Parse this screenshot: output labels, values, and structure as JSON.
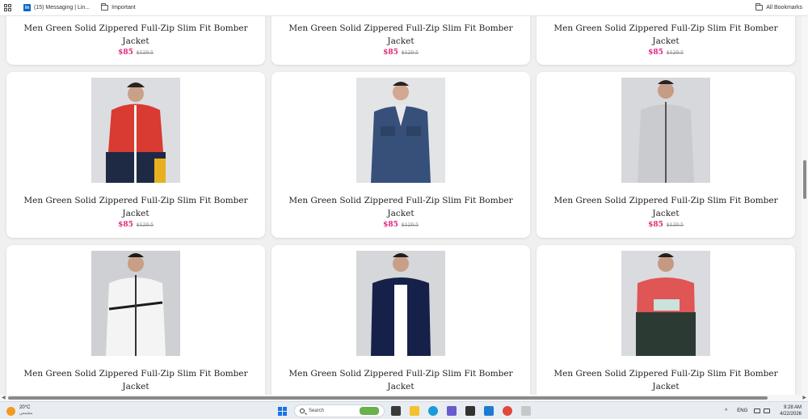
{
  "bookmarks": {
    "linkedin_label": "(15) Messaging | Lin...",
    "important_label": "Important",
    "all_bookmarks_label": "All Bookmarks"
  },
  "products": [
    {
      "title": "Men Green Solid Zippered Full-Zip Slim Fit Bomber Jacket",
      "price": "$85",
      "old_price": "$120.5"
    },
    {
      "title": "Men Green Solid Zippered Full-Zip Slim Fit Bomber Jacket",
      "price": "$85",
      "old_price": "$120.5"
    },
    {
      "title": "Men Green Solid Zippered Full-Zip Slim Fit Bomber Jacket",
      "price": "$85",
      "old_price": "$120.5"
    },
    {
      "title": "Men Green Solid Zippered Full-Zip Slim Fit Bomber Jacket",
      "price": "$85",
      "old_price": "$120.5"
    },
    {
      "title": "Men Green Solid Zippered Full-Zip Slim Fit Bomber Jacket",
      "price": "$85",
      "old_price": "$120.5"
    },
    {
      "title": "Men Green Solid Zippered Full-Zip Slim Fit Bomber Jacket",
      "price": "$85",
      "old_price": "$120.5"
    },
    {
      "title": "Men Green Solid Zippered Full-Zip Slim Fit Bomber Jacket",
      "price": "",
      "old_price": ""
    },
    {
      "title": "Men Green Solid Zippered Full-Zip Slim Fit Bomber Jacket",
      "price": "",
      "old_price": ""
    },
    {
      "title": "Men Green Solid Zippered Full-Zip Slim Fit Bomber Jacket",
      "price": "",
      "old_price": ""
    }
  ],
  "product_images": [
    {
      "jacket_color": "#d93a32",
      "accent": "#1e2a44",
      "accent2": "#e8b020",
      "bg": "#dcdde0"
    },
    {
      "jacket_color": "#36507a",
      "accent": "#2c4266",
      "accent2": "#4a6590",
      "bg": "#e3e4e6"
    },
    {
      "jacket_color": "#c9cbcf",
      "accent": "#aeb1b6",
      "accent2": "#e0e1e3",
      "bg": "#d7d8dc"
    },
    {
      "jacket_color": "#f4f4f4",
      "accent": "#1b1b1b",
      "accent2": "#ffffff",
      "bg": "#cfd0d4"
    },
    {
      "jacket_color": "#16214a",
      "accent": "#ffffff",
      "accent2": "#0f1838",
      "bg": "#d6d7db"
    },
    {
      "jacket_color": "#e05555",
      "accent": "#2c3a34",
      "accent2": "#c9e2dc",
      "bg": "#dadbdf"
    }
  ],
  "taskbar": {
    "temperature": "20°C",
    "weather_text": "مشمس",
    "search_label": "Search",
    "language": "ENG",
    "time": "9:28 AM",
    "date": "4/22/2026"
  },
  "colors": {
    "price": "#e2267a",
    "taskbar_bg": "#e8ecf3"
  }
}
